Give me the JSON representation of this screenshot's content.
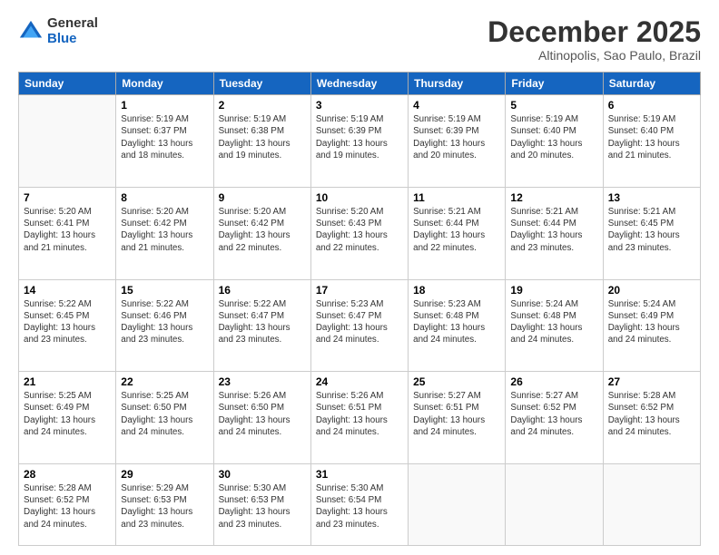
{
  "logo": {
    "general": "General",
    "blue": "Blue"
  },
  "title": {
    "month_year": "December 2025",
    "location": "Altinopolis, Sao Paulo, Brazil"
  },
  "days_of_week": [
    "Sunday",
    "Monday",
    "Tuesday",
    "Wednesday",
    "Thursday",
    "Friday",
    "Saturday"
  ],
  "weeks": [
    [
      {
        "day": "",
        "info": ""
      },
      {
        "day": "1",
        "info": "Sunrise: 5:19 AM\nSunset: 6:37 PM\nDaylight: 13 hours\nand 18 minutes."
      },
      {
        "day": "2",
        "info": "Sunrise: 5:19 AM\nSunset: 6:38 PM\nDaylight: 13 hours\nand 19 minutes."
      },
      {
        "day": "3",
        "info": "Sunrise: 5:19 AM\nSunset: 6:39 PM\nDaylight: 13 hours\nand 19 minutes."
      },
      {
        "day": "4",
        "info": "Sunrise: 5:19 AM\nSunset: 6:39 PM\nDaylight: 13 hours\nand 20 minutes."
      },
      {
        "day": "5",
        "info": "Sunrise: 5:19 AM\nSunset: 6:40 PM\nDaylight: 13 hours\nand 20 minutes."
      },
      {
        "day": "6",
        "info": "Sunrise: 5:19 AM\nSunset: 6:40 PM\nDaylight: 13 hours\nand 21 minutes."
      }
    ],
    [
      {
        "day": "7",
        "info": "Sunrise: 5:20 AM\nSunset: 6:41 PM\nDaylight: 13 hours\nand 21 minutes."
      },
      {
        "day": "8",
        "info": "Sunrise: 5:20 AM\nSunset: 6:42 PM\nDaylight: 13 hours\nand 21 minutes."
      },
      {
        "day": "9",
        "info": "Sunrise: 5:20 AM\nSunset: 6:42 PM\nDaylight: 13 hours\nand 22 minutes."
      },
      {
        "day": "10",
        "info": "Sunrise: 5:20 AM\nSunset: 6:43 PM\nDaylight: 13 hours\nand 22 minutes."
      },
      {
        "day": "11",
        "info": "Sunrise: 5:21 AM\nSunset: 6:44 PM\nDaylight: 13 hours\nand 22 minutes."
      },
      {
        "day": "12",
        "info": "Sunrise: 5:21 AM\nSunset: 6:44 PM\nDaylight: 13 hours\nand 23 minutes."
      },
      {
        "day": "13",
        "info": "Sunrise: 5:21 AM\nSunset: 6:45 PM\nDaylight: 13 hours\nand 23 minutes."
      }
    ],
    [
      {
        "day": "14",
        "info": "Sunrise: 5:22 AM\nSunset: 6:45 PM\nDaylight: 13 hours\nand 23 minutes."
      },
      {
        "day": "15",
        "info": "Sunrise: 5:22 AM\nSunset: 6:46 PM\nDaylight: 13 hours\nand 23 minutes."
      },
      {
        "day": "16",
        "info": "Sunrise: 5:22 AM\nSunset: 6:47 PM\nDaylight: 13 hours\nand 23 minutes."
      },
      {
        "day": "17",
        "info": "Sunrise: 5:23 AM\nSunset: 6:47 PM\nDaylight: 13 hours\nand 24 minutes."
      },
      {
        "day": "18",
        "info": "Sunrise: 5:23 AM\nSunset: 6:48 PM\nDaylight: 13 hours\nand 24 minutes."
      },
      {
        "day": "19",
        "info": "Sunrise: 5:24 AM\nSunset: 6:48 PM\nDaylight: 13 hours\nand 24 minutes."
      },
      {
        "day": "20",
        "info": "Sunrise: 5:24 AM\nSunset: 6:49 PM\nDaylight: 13 hours\nand 24 minutes."
      }
    ],
    [
      {
        "day": "21",
        "info": "Sunrise: 5:25 AM\nSunset: 6:49 PM\nDaylight: 13 hours\nand 24 minutes."
      },
      {
        "day": "22",
        "info": "Sunrise: 5:25 AM\nSunset: 6:50 PM\nDaylight: 13 hours\nand 24 minutes."
      },
      {
        "day": "23",
        "info": "Sunrise: 5:26 AM\nSunset: 6:50 PM\nDaylight: 13 hours\nand 24 minutes."
      },
      {
        "day": "24",
        "info": "Sunrise: 5:26 AM\nSunset: 6:51 PM\nDaylight: 13 hours\nand 24 minutes."
      },
      {
        "day": "25",
        "info": "Sunrise: 5:27 AM\nSunset: 6:51 PM\nDaylight: 13 hours\nand 24 minutes."
      },
      {
        "day": "26",
        "info": "Sunrise: 5:27 AM\nSunset: 6:52 PM\nDaylight: 13 hours\nand 24 minutes."
      },
      {
        "day": "27",
        "info": "Sunrise: 5:28 AM\nSunset: 6:52 PM\nDaylight: 13 hours\nand 24 minutes."
      }
    ],
    [
      {
        "day": "28",
        "info": "Sunrise: 5:28 AM\nSunset: 6:52 PM\nDaylight: 13 hours\nand 24 minutes."
      },
      {
        "day": "29",
        "info": "Sunrise: 5:29 AM\nSunset: 6:53 PM\nDaylight: 13 hours\nand 23 minutes."
      },
      {
        "day": "30",
        "info": "Sunrise: 5:30 AM\nSunset: 6:53 PM\nDaylight: 13 hours\nand 23 minutes."
      },
      {
        "day": "31",
        "info": "Sunrise: 5:30 AM\nSunset: 6:54 PM\nDaylight: 13 hours\nand 23 minutes."
      },
      {
        "day": "",
        "info": ""
      },
      {
        "day": "",
        "info": ""
      },
      {
        "day": "",
        "info": ""
      }
    ]
  ]
}
